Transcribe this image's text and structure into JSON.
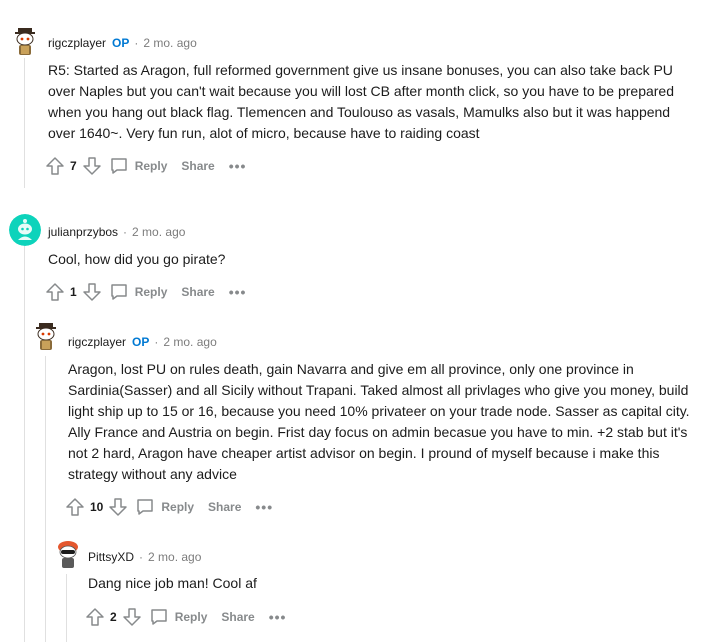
{
  "comments": [
    {
      "author": "rigczplayer",
      "op_badge": "OP",
      "separator": "·",
      "time": "2 mo. ago",
      "body": "R5: Started as Aragon, full reformed government give us insane bonuses, you can also take back PU over Naples but you can't wait because you will lost CB after month click, so you have to be prepared when you hang out black flag. Tlemencen and Toulouso as vasals, Mamulks also but it was happend over 1640~. Very fun run, alot of micro, because have to raiding coast",
      "score": "7",
      "reply_label": "Reply",
      "share_label": "Share",
      "more_label": "•••"
    },
    {
      "author": "julianprzybos",
      "separator": "·",
      "time": "2 mo. ago",
      "body": "Cool, how did you go pirate?",
      "score": "1",
      "reply_label": "Reply",
      "share_label": "Share",
      "more_label": "•••"
    },
    {
      "author": "rigczplayer",
      "op_badge": "OP",
      "separator": "·",
      "time": "2 mo. ago",
      "body": "Aragon, lost PU on rules death, gain Navarra and give em all province, only one province in Sardinia(Sasser) and all Sicily without Trapani. Taked almost all privlages who give you money, build light ship up to 15 or 16, because you need 10% privateer on your trade node. Sasser as capital city. Ally France and Austria on begin. Frist day focus on admin becasue you have to min. +2 stab but it's not 2 hard, Aragon have cheaper artist advisor on begin. I pround of myself because i make this strategy without any advice",
      "score": "10",
      "reply_label": "Reply",
      "share_label": "Share",
      "more_label": "•••"
    },
    {
      "author": "PittsyXD",
      "separator": "·",
      "time": "2 mo. ago",
      "body": "Dang nice job man! Cool af",
      "score": "2",
      "reply_label": "Reply",
      "share_label": "Share",
      "more_label": "•••"
    }
  ],
  "colors": {
    "op": "#0079d3",
    "meta": "#7c7c7c",
    "action": "#878a8c",
    "thread_line": "#e0e0e0"
  }
}
